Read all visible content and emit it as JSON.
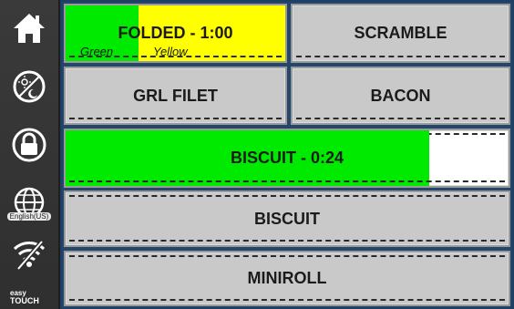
{
  "sidebar": {
    "language_label": "English(US)",
    "brand_line1": "easy",
    "brand_line2": "TOUCH"
  },
  "colors": {
    "green": "#00ea00",
    "yellow": "#ffff00",
    "panel_bg": "#25466b",
    "tile_bg": "#c9c9c9"
  },
  "tiles": {
    "folded": {
      "label": "FOLDED - 1:00",
      "legend_green": "Green",
      "legend_yellow": "Yellow",
      "green_fraction": 0.33
    },
    "scramble": {
      "label": "SCRAMBLE"
    },
    "grl_filet": {
      "label": "GRL FILET"
    },
    "bacon": {
      "label": "BACON"
    },
    "biscuit_timer": {
      "label": "BISCUIT - 0:24",
      "progress": 0.82
    },
    "biscuit": {
      "label": "BISCUIT"
    },
    "miniroll": {
      "label": "MINIROLL"
    }
  }
}
